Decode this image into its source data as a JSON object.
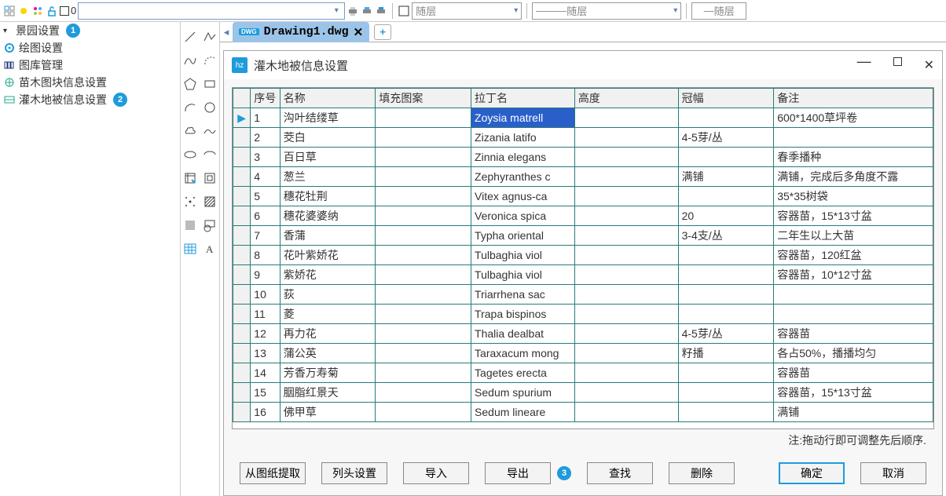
{
  "toolbar": {
    "zero_label": "0",
    "layer1": "随层",
    "layer2": "随层",
    "layer3": "随层"
  },
  "sidebar": {
    "items": [
      {
        "label": "景园设置",
        "badge": "1"
      },
      {
        "label": "绘图设置"
      },
      {
        "label": "图库管理"
      },
      {
        "label": "苗木图块信息设置"
      },
      {
        "label": "灌木地被信息设置",
        "badge": "2"
      }
    ]
  },
  "tab": {
    "filename": "Drawing1.dwg"
  },
  "dialog": {
    "title": "灌木地被信息设置",
    "note": "注:拖动行即可调整先后顺序.",
    "headers": {
      "idx": "序号",
      "name": "名称",
      "fill": "填充图案",
      "latin": "拉丁名",
      "height": "高度",
      "crown": "冠幅",
      "remark": "备注"
    },
    "rows": [
      {
        "idx": "1",
        "name": "沟叶结缕草",
        "latin": "Zoysia matrell",
        "height": "",
        "crown": "",
        "remark": "600*1400草坪卷",
        "selected": true
      },
      {
        "idx": "2",
        "name": "茭白",
        "latin": "Zizania latifo",
        "height": "",
        "crown": "4-5芽/丛",
        "remark": ""
      },
      {
        "idx": "3",
        "name": "百日草",
        "latin": "Zinnia elegans",
        "height": "",
        "crown": "",
        "remark": "春季播种"
      },
      {
        "idx": "4",
        "name": "葱兰",
        "latin": "Zephyranthes c",
        "height": "",
        "crown": "满铺",
        "remark": "满铺，完成后多角度不露"
      },
      {
        "idx": "5",
        "name": "穗花牡荆",
        "latin": "Vitex agnus-ca",
        "height": "",
        "crown": "",
        "remark": "35*35树袋"
      },
      {
        "idx": "6",
        "name": "穗花婆婆纳",
        "latin": "Veronica spica",
        "height": "",
        "crown": "20",
        "remark": "容器苗，15*13寸盆"
      },
      {
        "idx": "7",
        "name": "香蒲",
        "latin": "Typha oriental",
        "height": "",
        "crown": "3-4支/丛",
        "remark": "二年生以上大苗"
      },
      {
        "idx": "8",
        "name": "花叶紫娇花",
        "latin": "Tulbaghia viol",
        "height": "",
        "crown": "",
        "remark": "容器苗，120红盆"
      },
      {
        "idx": "9",
        "name": "紫娇花",
        "latin": "Tulbaghia viol",
        "height": "",
        "crown": "",
        "remark": "容器苗，10*12寸盆"
      },
      {
        "idx": "10",
        "name": "荻",
        "latin": "Triarrhena sac",
        "height": "",
        "crown": "",
        "remark": ""
      },
      {
        "idx": "11",
        "name": "菱",
        "latin": "Trapa bispinos",
        "height": "",
        "crown": "",
        "remark": ""
      },
      {
        "idx": "12",
        "name": "再力花",
        "latin": "Thalia dealbat",
        "height": "",
        "crown": "4-5芽/丛",
        "remark": "容器苗"
      },
      {
        "idx": "13",
        "name": "蒲公英",
        "latin": "Taraxacum mong",
        "height": "",
        "crown": "籽播",
        "remark": "各占50%，播播均匀"
      },
      {
        "idx": "14",
        "name": "芳香万寿菊",
        "latin": "Tagetes erecta",
        "height": "",
        "crown": "",
        "remark": "容器苗"
      },
      {
        "idx": "15",
        "name": "胭脂红景天",
        "latin": "Sedum spurium",
        "height": "",
        "crown": "",
        "remark": "容器苗，15*13寸盆"
      },
      {
        "idx": "16",
        "name": "佛甲草",
        "latin": "Sedum lineare",
        "height": "",
        "crown": "",
        "remark": "满铺"
      }
    ],
    "buttons": {
      "extract": "从图纸提取",
      "colset": "列头设置",
      "import": "导入",
      "export": "导出",
      "export_badge": "3",
      "find": "查找",
      "delete": "删除",
      "ok": "确定",
      "cancel": "取消"
    }
  }
}
